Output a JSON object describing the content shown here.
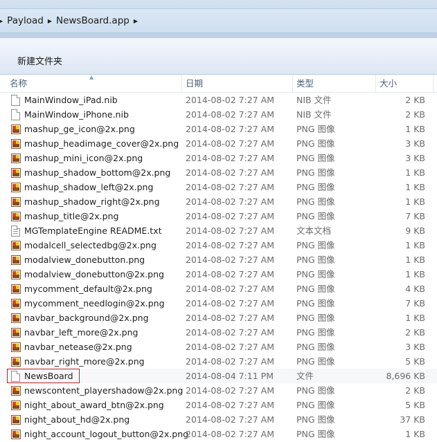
{
  "breadcrumbs": [
    "Payload",
    "NewsBoard.app"
  ],
  "toolbar": {
    "new_folder": "新建文件夹"
  },
  "columns": {
    "name": "名称",
    "date": "日期",
    "type": "类型",
    "size": "大小"
  },
  "files": [
    {
      "name": "MainWindow_iPad.nib",
      "date": "2014-08-02 7:27 AM",
      "type": "NIB 文件",
      "size": "2 KB",
      "icon": "document-icon"
    },
    {
      "name": "MainWindow_iPhone.nib",
      "date": "2014-08-02 7:27 AM",
      "type": "NIB 文件",
      "size": "2 KB",
      "icon": "document-icon"
    },
    {
      "name": "mashup_ge_icon@2x.png",
      "date": "2014-08-02 7:27 AM",
      "type": "PNG 图像",
      "size": "1 KB",
      "icon": "image-icon"
    },
    {
      "name": "mashup_headimage_cover@2x.png",
      "date": "2014-08-02 7:27 AM",
      "type": "PNG 图像",
      "size": "3 KB",
      "icon": "image-icon"
    },
    {
      "name": "mashup_mini_icon@2x.png",
      "date": "2014-08-02 7:27 AM",
      "type": "PNG 图像",
      "size": "3 KB",
      "icon": "image-icon"
    },
    {
      "name": "mashup_shadow_bottom@2x.png",
      "date": "2014-08-02 7:27 AM",
      "type": "PNG 图像",
      "size": "1 KB",
      "icon": "image-icon"
    },
    {
      "name": "mashup_shadow_left@2x.png",
      "date": "2014-08-02 7:27 AM",
      "type": "PNG 图像",
      "size": "1 KB",
      "icon": "image-icon"
    },
    {
      "name": "mashup_shadow_right@2x.png",
      "date": "2014-08-02 7:27 AM",
      "type": "PNG 图像",
      "size": "1 KB",
      "icon": "image-icon"
    },
    {
      "name": "mashup_title@2x.png",
      "date": "2014-08-02 7:27 AM",
      "type": "PNG 图像",
      "size": "7 KB",
      "icon": "image-icon"
    },
    {
      "name": "MGTemplateEngine README.txt",
      "date": "2014-08-02 7:27 AM",
      "type": "文本文档",
      "size": "9 KB",
      "icon": "text-document-icon"
    },
    {
      "name": "modalcell_selectedbg@2x.png",
      "date": "2014-08-02 7:27 AM",
      "type": "PNG 图像",
      "size": "1 KB",
      "icon": "image-icon"
    },
    {
      "name": "modalview_donebutton.png",
      "date": "2014-08-02 7:27 AM",
      "type": "PNG 图像",
      "size": "1 KB",
      "icon": "image-icon"
    },
    {
      "name": "modalview_donebutton@2x.png",
      "date": "2014-08-02 7:27 AM",
      "type": "PNG 图像",
      "size": "1 KB",
      "icon": "image-icon"
    },
    {
      "name": "mycomment_default@2x.png",
      "date": "2014-08-02 7:27 AM",
      "type": "PNG 图像",
      "size": "4 KB",
      "icon": "image-icon"
    },
    {
      "name": "mycomment_needlogin@2x.png",
      "date": "2014-08-02 7:27 AM",
      "type": "PNG 图像",
      "size": "7 KB",
      "icon": "image-icon"
    },
    {
      "name": "navbar_background@2x.png",
      "date": "2014-08-02 7:27 AM",
      "type": "PNG 图像",
      "size": "1 KB",
      "icon": "image-icon"
    },
    {
      "name": "navbar_left_more@2x.png",
      "date": "2014-08-02 7:27 AM",
      "type": "PNG 图像",
      "size": "2 KB",
      "icon": "image-icon"
    },
    {
      "name": "navbar_netease@2x.png",
      "date": "2014-08-02 7:27 AM",
      "type": "PNG 图像",
      "size": "3 KB",
      "icon": "image-icon"
    },
    {
      "name": "navbar_right_more@2x.png",
      "date": "2014-08-02 7:27 AM",
      "type": "PNG 图像",
      "size": "5 KB",
      "icon": "image-icon"
    },
    {
      "name": "NewsBoard",
      "date": "2014-08-04 7:11 PM",
      "type": "文件",
      "size": "8,696 KB",
      "icon": "document-icon"
    },
    {
      "name": "newscontent_playershadow@2x.png",
      "date": "2014-08-02 7:27 AM",
      "type": "PNG 图像",
      "size": "2 KB",
      "icon": "image-icon"
    },
    {
      "name": "night_about_award_btn@2x.png",
      "date": "2014-08-02 7:27 AM",
      "type": "PNG 图像",
      "size": "5 KB",
      "icon": "image-icon"
    },
    {
      "name": "night_about_hd@2x.png",
      "date": "2014-08-02 7:27 AM",
      "type": "PNG 图像",
      "size": "37 KB",
      "icon": "image-icon"
    },
    {
      "name": "night_account_logout_button@2x.png",
      "date": "2014-08-02 7:27 AM",
      "type": "PNG 图像",
      "size": "1 KB",
      "icon": "image-icon"
    }
  ],
  "selected_file": "NewsBoard",
  "colors": {
    "selection_outline": "#d0191f",
    "header_text": "#4c607a",
    "meta_text": "#6b6b6b"
  }
}
